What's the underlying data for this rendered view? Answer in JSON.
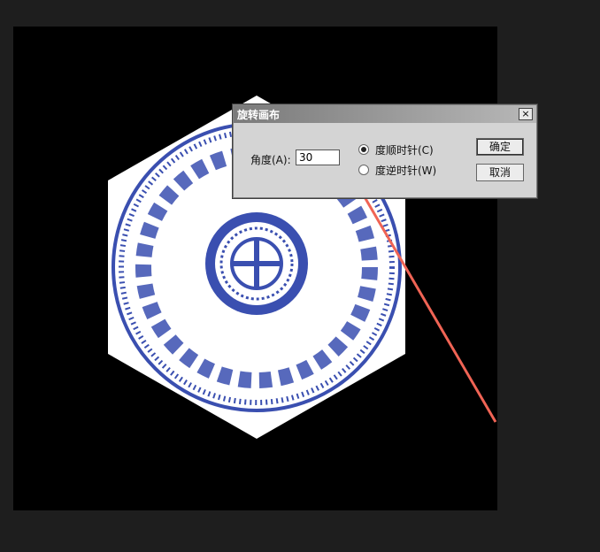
{
  "dialog": {
    "title": "旋转画布",
    "close_symbol": "×",
    "angle_label": "角度(A):",
    "angle_value": "30",
    "cw_label": "度顺时针(C)",
    "ccw_label": "度逆时针(W)",
    "ok_label": "确定",
    "cancel_label": "取消",
    "selected_direction": "cw"
  },
  "colors": {
    "canvas": "#000000",
    "pattern_blue": "#3a4fb0",
    "annotation_arrow": "#f06455"
  }
}
